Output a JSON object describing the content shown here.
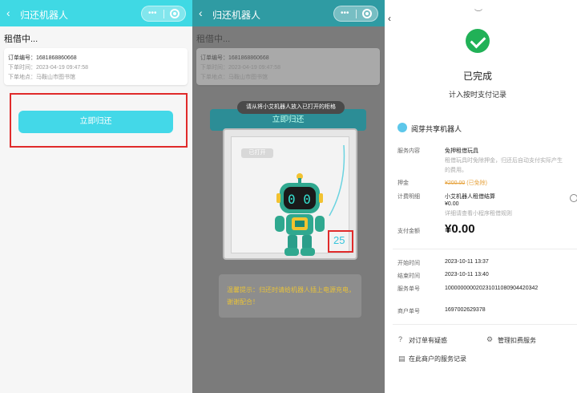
{
  "panel1": {
    "header": {
      "back_icon": "‹",
      "title": "归还机器人",
      "more_icon": "•••"
    },
    "status": "租借中...",
    "order": {
      "number": "订单编号：1681868860668",
      "time": "下单时间：2023-04-19 09:47:58",
      "place": "下单地点：马鞍山市图书馆"
    },
    "return_button": "立即归还"
  },
  "panel2": {
    "header": {
      "back_icon": "‹",
      "title": "归还机器人",
      "more_icon": "•••"
    },
    "status": "租借中...",
    "order": {
      "number": "订单编号：1681868860668",
      "time": "下单时间：2023-04-19 09:47:58",
      "place": "下单地点：马鞍山市图书馆"
    },
    "return_button": "立即归还",
    "tooltip": "请从将小艾机器人放入已打开的柜格",
    "door_tag": "已打开",
    "cabinet_number": "25",
    "warning": "温馨提示：归还时请给机器人插上电源充电，谢谢配合！"
  },
  "panel3": {
    "top_chevron": "︶",
    "back_icon": "‹",
    "status_title": "已完成",
    "status_sub": "计入按时支付记录",
    "merchant": "阅芽共享机器人",
    "rows": {
      "service_label": "服务内容",
      "service_value": "免押租借玩具",
      "service_note": "租借玩具时免除押金，归还后自动支付实际产生的费用。",
      "deposit_label": "押金",
      "deposit_value": "¥200.00",
      "deposit_note": "(已免除)",
      "fee_label": "计费明细",
      "fee_value": "小艾机器人租借结算",
      "fee_amount": "¥0.00",
      "fee_note": "详细请查看小程序租借规则",
      "pay_label": "支付金额",
      "pay_value": "¥0.00",
      "start_label": "开始时间",
      "start_value": "2023-10-11 13:37",
      "end_label": "结束时间",
      "end_value": "2023-10-11 13:40",
      "service_no_label": "服务单号",
      "service_no_value": "100000000020231011080904420342",
      "merchant_no_label": "商户单号",
      "merchant_no_value": "1697002629378"
    },
    "actions": {
      "doubt": "对订单有疑惑",
      "manage": "管理扣费服务",
      "records": "在此商户的服务记录"
    }
  }
}
